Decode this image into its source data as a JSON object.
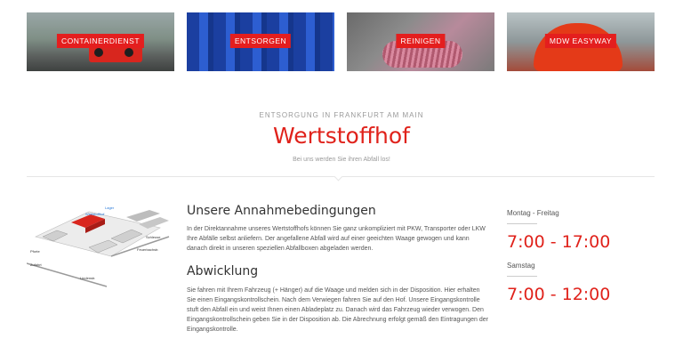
{
  "tiles": [
    {
      "label": "CONTAINERDIENST"
    },
    {
      "label": "ENTSORGEN"
    },
    {
      "label": "REINIGEN"
    },
    {
      "label": "MDW EASYWAY"
    }
  ],
  "section": {
    "kicker": "ENTSORGUNG IN FRANKFURT AM MAIN",
    "title": "Wertstoffhof",
    "subtitle": "Bei uns werden Sie ihren Abfall los!"
  },
  "map": {
    "labels": {
      "lager": "Lager",
      "wertstoffhof": "Wertstoffhof",
      "schleuse": "Schleuse",
      "pforte": "Pforte",
      "zufahrt": "Zufahrt",
      "strasse1": "Lindenstr.",
      "strasse2": "Feuerbachstr."
    }
  },
  "annahme": {
    "heading": "Unsere Annahmebedingungen",
    "text": "In der Direktannahme unseres Wertstoffhofs können Sie ganz unkompliziert mit PKW, Transporter oder LKW Ihre Abfälle selbst anliefern. Der angefallene Abfall wird auf einer geeichten Waage gewogen und kann danach direkt in unseren speziellen Abfallboxen abgeladen werden."
  },
  "abwicklung": {
    "heading": "Abwicklung",
    "text": "Sie fahren mit Ihrem Fahrzeug (+ Hänger) auf die Waage und melden sich in der Disposition. Hier erhalten Sie einen Eingangskontrollschein. Nach dem Verwiegen fahren Sie auf den Hof. Unsere Eingangskontrolle stuft den Abfall ein und weist Ihnen einen Abladeplatz zu. Danach wird das Fahrzeug wieder verwogen. Den Eingangskontrollschein geben Sie in der Disposition ab. Die Abrechnung erfolgt gemäß den Eintragungen der Eingangskontrolle."
  },
  "hours": [
    {
      "day": "Montag - Freitag",
      "time": "7:00 - 17:00"
    },
    {
      "day": "Samstag",
      "time": "7:00 - 12:00"
    }
  ],
  "colors": {
    "accent": "#e0221b"
  }
}
